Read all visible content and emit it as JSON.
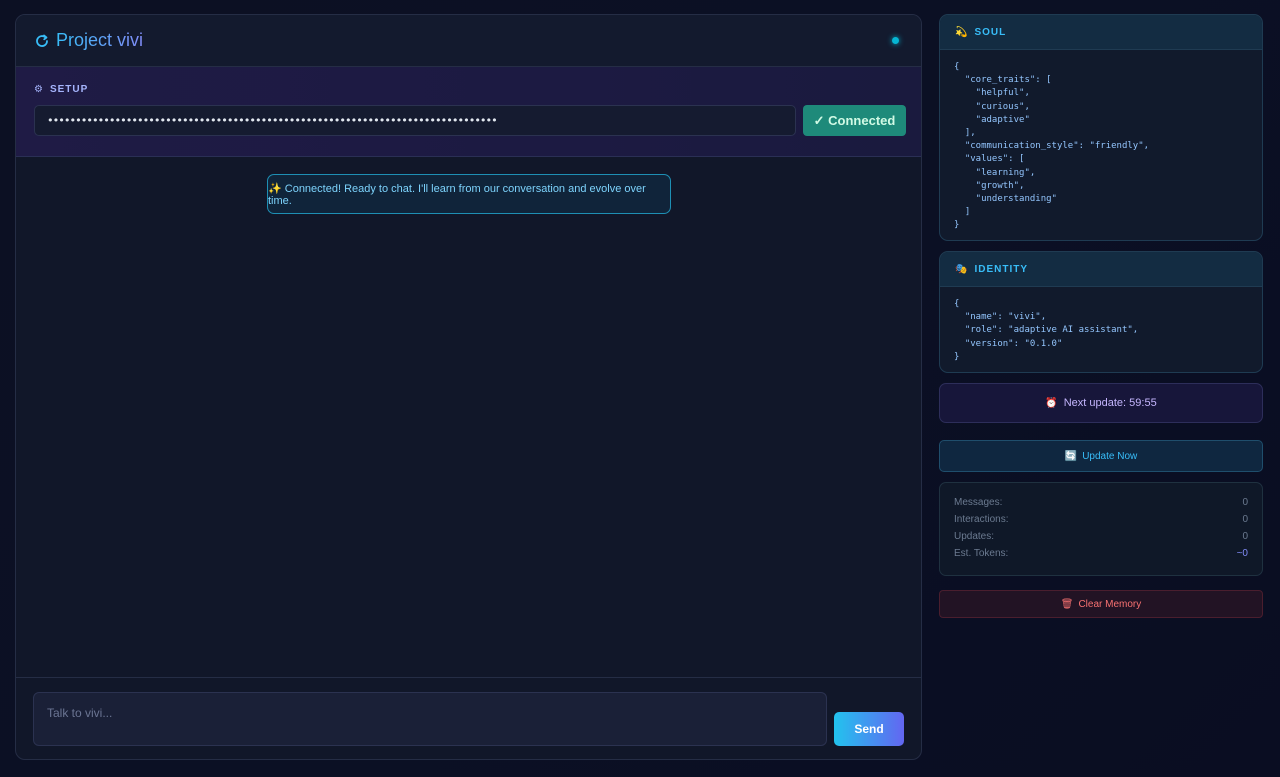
{
  "header": {
    "title": "Project vivi"
  },
  "setup": {
    "label": "SETUP",
    "api_key_value": "••••••••••••••••••••••••••••••••••••••••••••••••••••••••••••••••••••••••••••••••",
    "connect_label": "✓ Connected"
  },
  "chat": {
    "system_message": "✨ Connected! Ready to chat. I'll learn from our conversation and evolve over time."
  },
  "composer": {
    "placeholder": "Talk to vivi...",
    "send_label": "Send"
  },
  "soul": {
    "label": "SOUL",
    "json": "{\n  \"core_traits\": [\n    \"helpful\",\n    \"curious\",\n    \"adaptive\"\n  ],\n  \"communication_style\": \"friendly\",\n  \"values\": [\n    \"learning\",\n    \"growth\",\n    \"understanding\"\n  ]\n}"
  },
  "identity": {
    "label": "IDENTITY",
    "json": "{\n  \"name\": \"vivi\",\n  \"role\": \"adaptive AI assistant\",\n  \"version\": \"0.1.0\"\n}"
  },
  "timer": {
    "text": "Next update: 59:55"
  },
  "update_now": {
    "label": "Update Now"
  },
  "stats": [
    {
      "label": "Messages:",
      "value": "0"
    },
    {
      "label": "Interactions:",
      "value": "0"
    },
    {
      "label": "Updates:",
      "value": "0"
    },
    {
      "label": "Est. Tokens:",
      "value": "~0"
    }
  ],
  "clear_memory": {
    "label": "Clear Memory"
  },
  "colors": {
    "accent": "#38bdf8",
    "connected": "#1e8a7a",
    "danger": "#f87171",
    "status_dot": "#06b6d4"
  }
}
